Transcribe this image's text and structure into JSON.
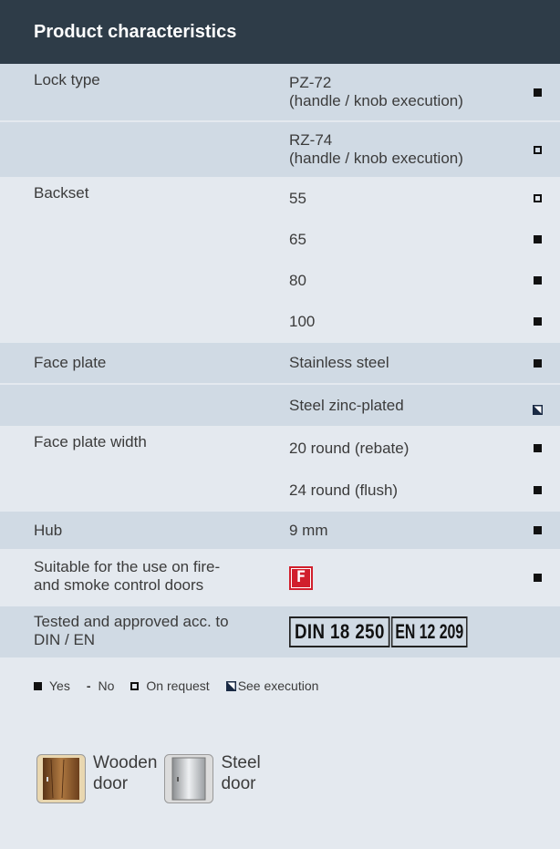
{
  "title": "Product characteristics",
  "rows": {
    "lock_type": {
      "label": "Lock type",
      "v1": "PZ-72\n(handle / knob execution)",
      "v2": "RZ-74\n(handle / knob execution)"
    },
    "backset": {
      "label": "Backset",
      "v1": "55",
      "v2": "65",
      "v3": "80",
      "v4": "100"
    },
    "face_plate": {
      "label": "Face plate",
      "v1": "Stainless steel",
      "v2": "Steel zinc-plated"
    },
    "face_plate_width": {
      "label": "Face plate width",
      "v1": "20 round (rebate)",
      "v2": "24 round (flush)"
    },
    "hub": {
      "label": "Hub",
      "v1": "9 mm"
    },
    "fire": {
      "label": "Suitable for the use on fire-\nand smoke control doors",
      "symbol": "F"
    },
    "tested": {
      "label": "Tested and approved acc. to\nDIN / EN",
      "din": "DIN 18 250",
      "en": "EN 12 209"
    }
  },
  "legend": {
    "yes": "Yes",
    "no_symbol": "-",
    "no": "No",
    "on_request": "On request",
    "see_execution": "See execution"
  },
  "doors": {
    "wooden": "Wooden\ndoor",
    "steel": "Steel\ndoor"
  },
  "colors": {
    "header": "#2e3c48",
    "row_light": "#d0dae4",
    "row_dark": "#e4e9ef",
    "fire_red": "#d11f2c"
  }
}
